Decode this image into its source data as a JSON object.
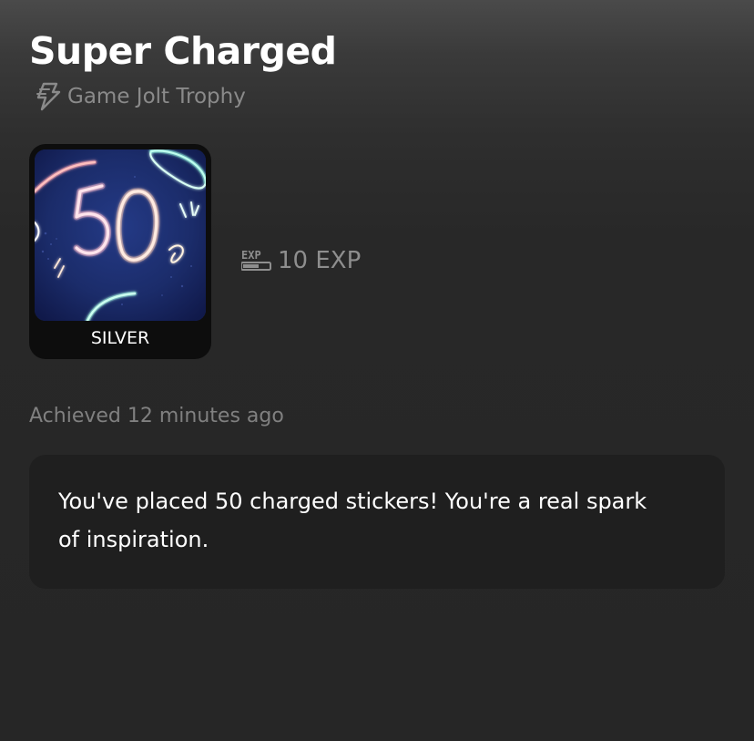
{
  "trophy": {
    "title": "Super Charged",
    "source_label": "Game Jolt Trophy",
    "tier": "SILVER",
    "exp_badge": "EXP",
    "exp": "10 EXP",
    "achieved": "Achieved 12 minutes ago",
    "description": "You've placed 50 charged stickers! You're a real spark of inspiration.",
    "image_text": "50"
  },
  "colors": {
    "background_top": "#4a4a4a",
    "background": "#262626",
    "card": "#1f1f1f",
    "trophy_frame": "#0d0d0d",
    "image_bg": "#1a2e6e",
    "muted_text": "#8a8a8a"
  },
  "icons": {
    "source": "lightning-bolt-icon",
    "exp": "exp-bar-icon"
  }
}
